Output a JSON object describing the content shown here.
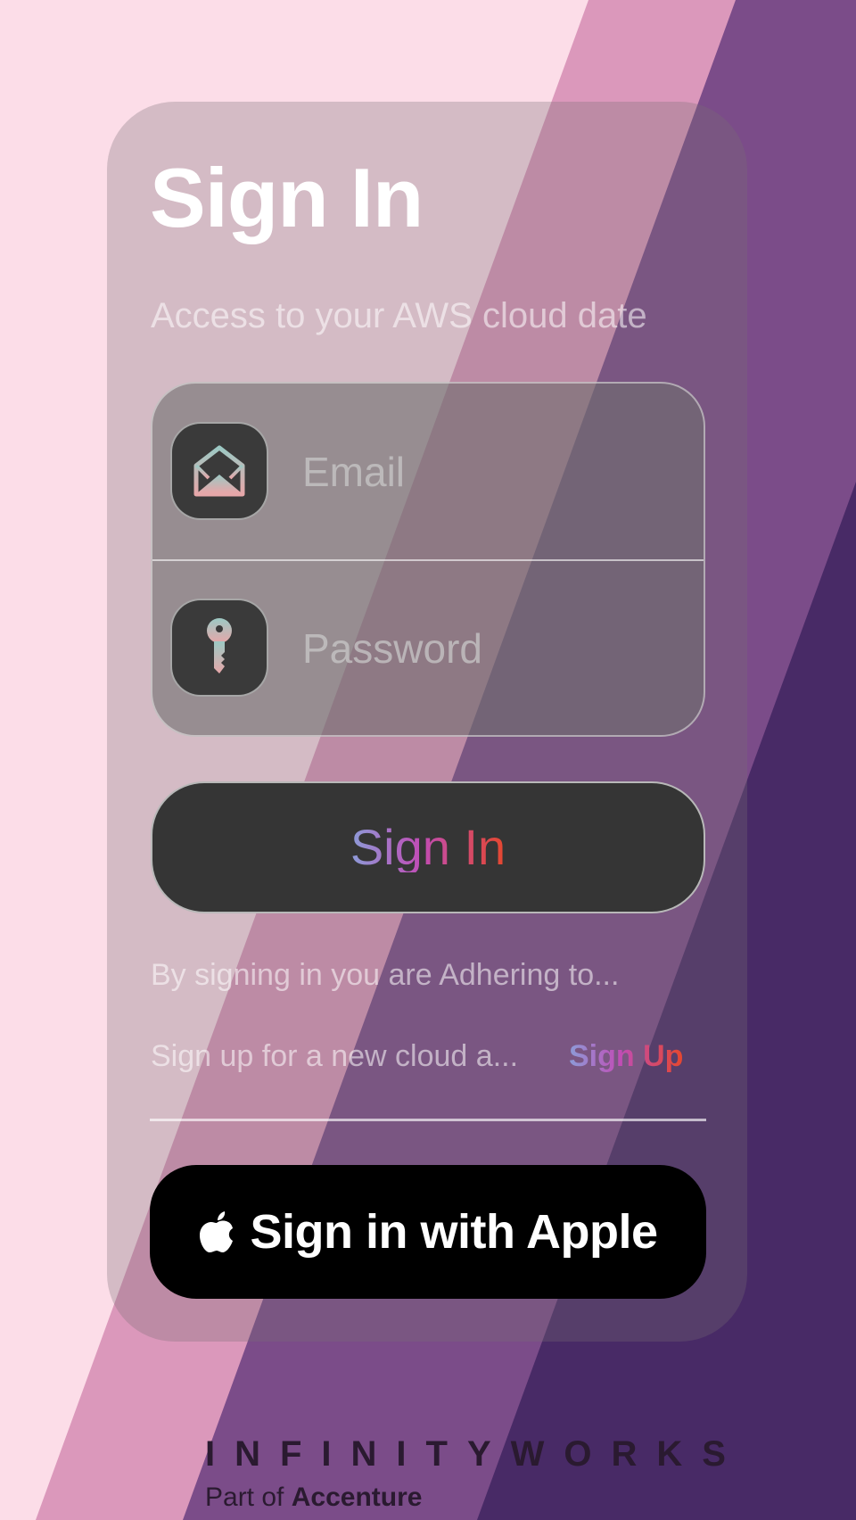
{
  "header": {
    "title": "Sign In",
    "subtitle": "Access to your AWS cloud date"
  },
  "form": {
    "email": {
      "placeholder": "Email",
      "value": "",
      "icon": "envelope-icon"
    },
    "password": {
      "placeholder": "Password",
      "value": "",
      "icon": "key-icon"
    }
  },
  "actions": {
    "signin_label": "Sign In",
    "terms_text": "By signing in you are Adhering  to...",
    "signup_prompt": "Sign up for a new cloud a...",
    "signup_link": "Sign Up",
    "apple_label": "Sign in with Apple",
    "apple_icon": "apple-logo-icon"
  },
  "branding": {
    "logo_text": "INFINITYWORKS",
    "part_of_prefix": "Part of",
    "part_of_company": "Accenture"
  },
  "colors": {
    "background_light": "#fcdde8",
    "stripe_pink": "#db98bb",
    "stripe_mauve": "#7b4c89",
    "stripe_dark": "#482a66",
    "accent_gradient_start": "#8c9cd8",
    "accent_gradient_mid": "#c04db6",
    "accent_gradient_end": "#e5472e",
    "button_dark": "#353535",
    "apple_button": "#000000"
  }
}
